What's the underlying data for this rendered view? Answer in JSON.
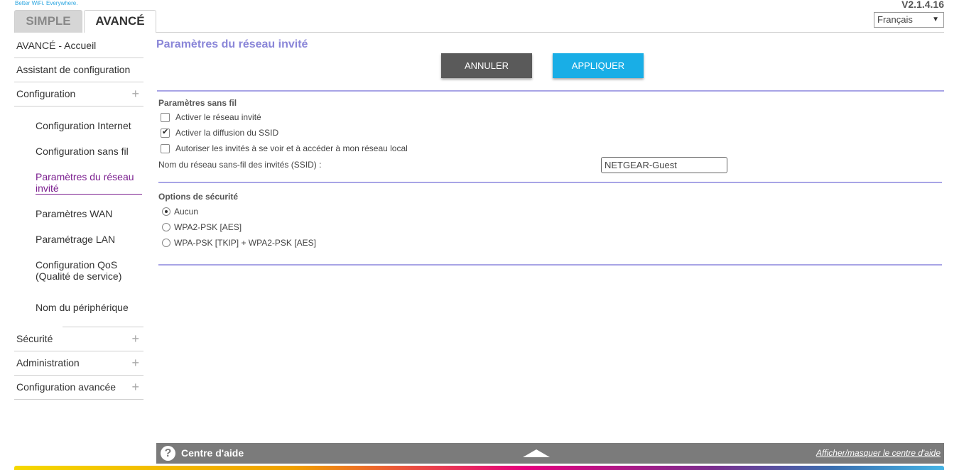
{
  "brand": {
    "tagline": "Better WiFi. Everywhere."
  },
  "tabs": {
    "simple": "SIMPLE",
    "advanced": "AVANCÉ"
  },
  "version": "V2.1.4.16",
  "language": {
    "selected": "Français"
  },
  "sidebar": {
    "home": "AVANCÉ - Accueil",
    "wizard": "Assistant de configuration",
    "configuration": "Configuration",
    "sub": {
      "internet": "Configuration Internet",
      "wireless": "Configuration sans fil",
      "guest_line1": "Paramètres du réseau",
      "guest_line2": "invité",
      "wan": "Paramètres WAN",
      "lan": "Paramétrage LAN",
      "qos_line1": "Configuration QoS",
      "qos_line2": "(Qualité de service)",
      "device_name": "Nom du périphérique"
    },
    "security": "Sécurité",
    "administration": "Administration",
    "advanced_config": "Configuration avancée",
    "expand_symbol": "+"
  },
  "main": {
    "title": "Paramètres du réseau invité",
    "cancel_label": "ANNULER",
    "apply_label": "APPLIQUER",
    "wireless_section": {
      "title": "Paramètres sans fil",
      "enable_guest": {
        "label": "Activer le réseau invité",
        "checked": false
      },
      "broadcast_ssid": {
        "label": "Activer la diffusion du SSID",
        "checked": true
      },
      "allow_local": {
        "label": "Autoriser les invités à se voir et à accéder à mon réseau local",
        "checked": false
      },
      "ssid_label": "Nom du réseau sans-fil des invités (SSID) :",
      "ssid_value": "NETGEAR-Guest"
    },
    "security_section": {
      "title": "Options de sécurité",
      "options": [
        {
          "label": "Aucun",
          "checked": true
        },
        {
          "label": "WPA2-PSK [AES]",
          "checked": false
        },
        {
          "label": "WPA-PSK [TKIP] + WPA2-PSK [AES]",
          "checked": false
        }
      ]
    }
  },
  "help": {
    "icon": "question-icon",
    "title": "Centre d'aide",
    "toggle_link": "Afficher/masquer le centre d'aide"
  },
  "colors": {
    "accent_title": "#8a86d8",
    "apply_button": "#19aee6",
    "cancel_button": "#5a5a5a",
    "active_nav": "#7b1f8f"
  }
}
